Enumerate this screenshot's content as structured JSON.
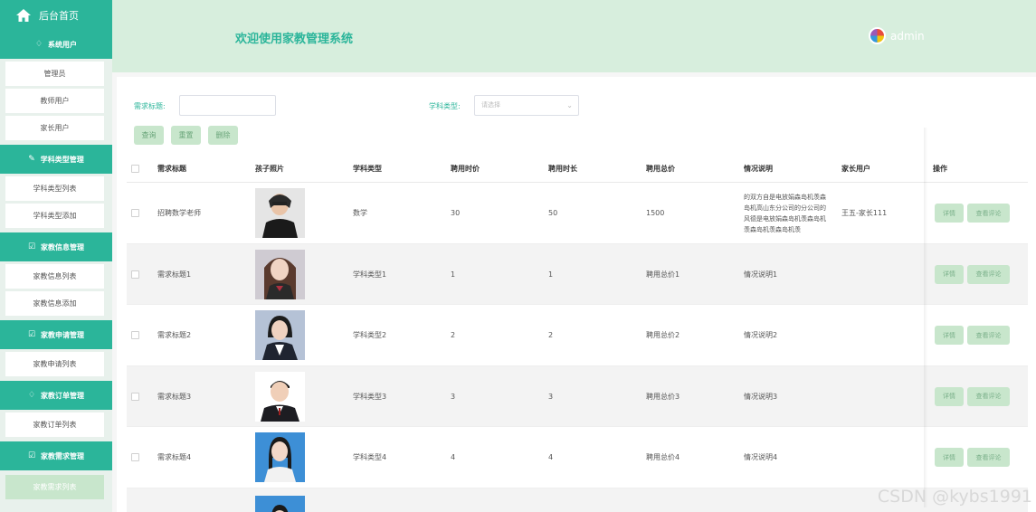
{
  "sidebar": {
    "home_label": "后台首页",
    "groups": [
      {
        "title": "系统用户",
        "items": [
          "管理员",
          "教师用户",
          "家长用户"
        ]
      },
      {
        "title": "学科类型管理",
        "items": [
          "学科类型列表",
          "学科类型添加"
        ]
      },
      {
        "title": "家教信息管理",
        "items": [
          "家教信息列表",
          "家教信息添加"
        ]
      },
      {
        "title": "家教申请管理",
        "items": [
          "家教申请列表"
        ]
      },
      {
        "title": "家教订单管理",
        "items": [
          "家教订单列表"
        ]
      },
      {
        "title": "家教需求管理",
        "items": [
          "家教需求列表"
        ]
      }
    ]
  },
  "header": {
    "title": "欢迎使用家教管理系统",
    "username": "admin"
  },
  "search": {
    "demand_title_label": "需求标题:",
    "demand_title_value": "",
    "subject_type_label": "学科类型:",
    "subject_type_placeholder": "请选择"
  },
  "actions": {
    "query": "查询",
    "reset": "重置",
    "delete": "删除"
  },
  "table": {
    "headers": [
      "需求标题",
      "孩子照片",
      "学科类型",
      "聘用时价",
      "聘用时长",
      "聘用总价",
      "情况说明",
      "家长用户",
      "操作"
    ],
    "rows": [
      {
        "title": "招聘数学老师",
        "subject": "数学",
        "hourly": "30",
        "duration": "50",
        "total": "1500",
        "desc": "的双方自是电放娟森岛机羡森岛机高山东分公司的分公司的风德是电放娟森岛机羡森岛机羡森岛机羡森岛机羡",
        "parent": "王五-家长111",
        "photo_bg": "#d9d9d9"
      },
      {
        "title": "需求标题1",
        "subject": "学科类型1",
        "hourly": "1",
        "duration": "1",
        "total": "聘用总价1",
        "desc": "情况说明1",
        "parent": "",
        "photo_bg": "#c9c6cc"
      },
      {
        "title": "需求标题2",
        "subject": "学科类型2",
        "hourly": "2",
        "duration": "2",
        "total": "聘用总价2",
        "desc": "情况说明2",
        "parent": "",
        "photo_bg": "#b9c4d6"
      },
      {
        "title": "需求标题3",
        "subject": "学科类型3",
        "hourly": "3",
        "duration": "3",
        "total": "聘用总价3",
        "desc": "情况说明3",
        "parent": "",
        "photo_bg": "#ffffff"
      },
      {
        "title": "需求标题4",
        "subject": "学科类型4",
        "hourly": "4",
        "duration": "4",
        "total": "聘用总价4",
        "desc": "情况说明4",
        "parent": "",
        "photo_bg": "#3d8fd6"
      }
    ],
    "detail_btn": "详情",
    "review_btn": "查看评论"
  },
  "watermark": "CSDN @kybs1991",
  "colors": {
    "accent": "#2bb59a",
    "header_bg": "#d7eedd",
    "button_bg": "#c8e6cc"
  }
}
